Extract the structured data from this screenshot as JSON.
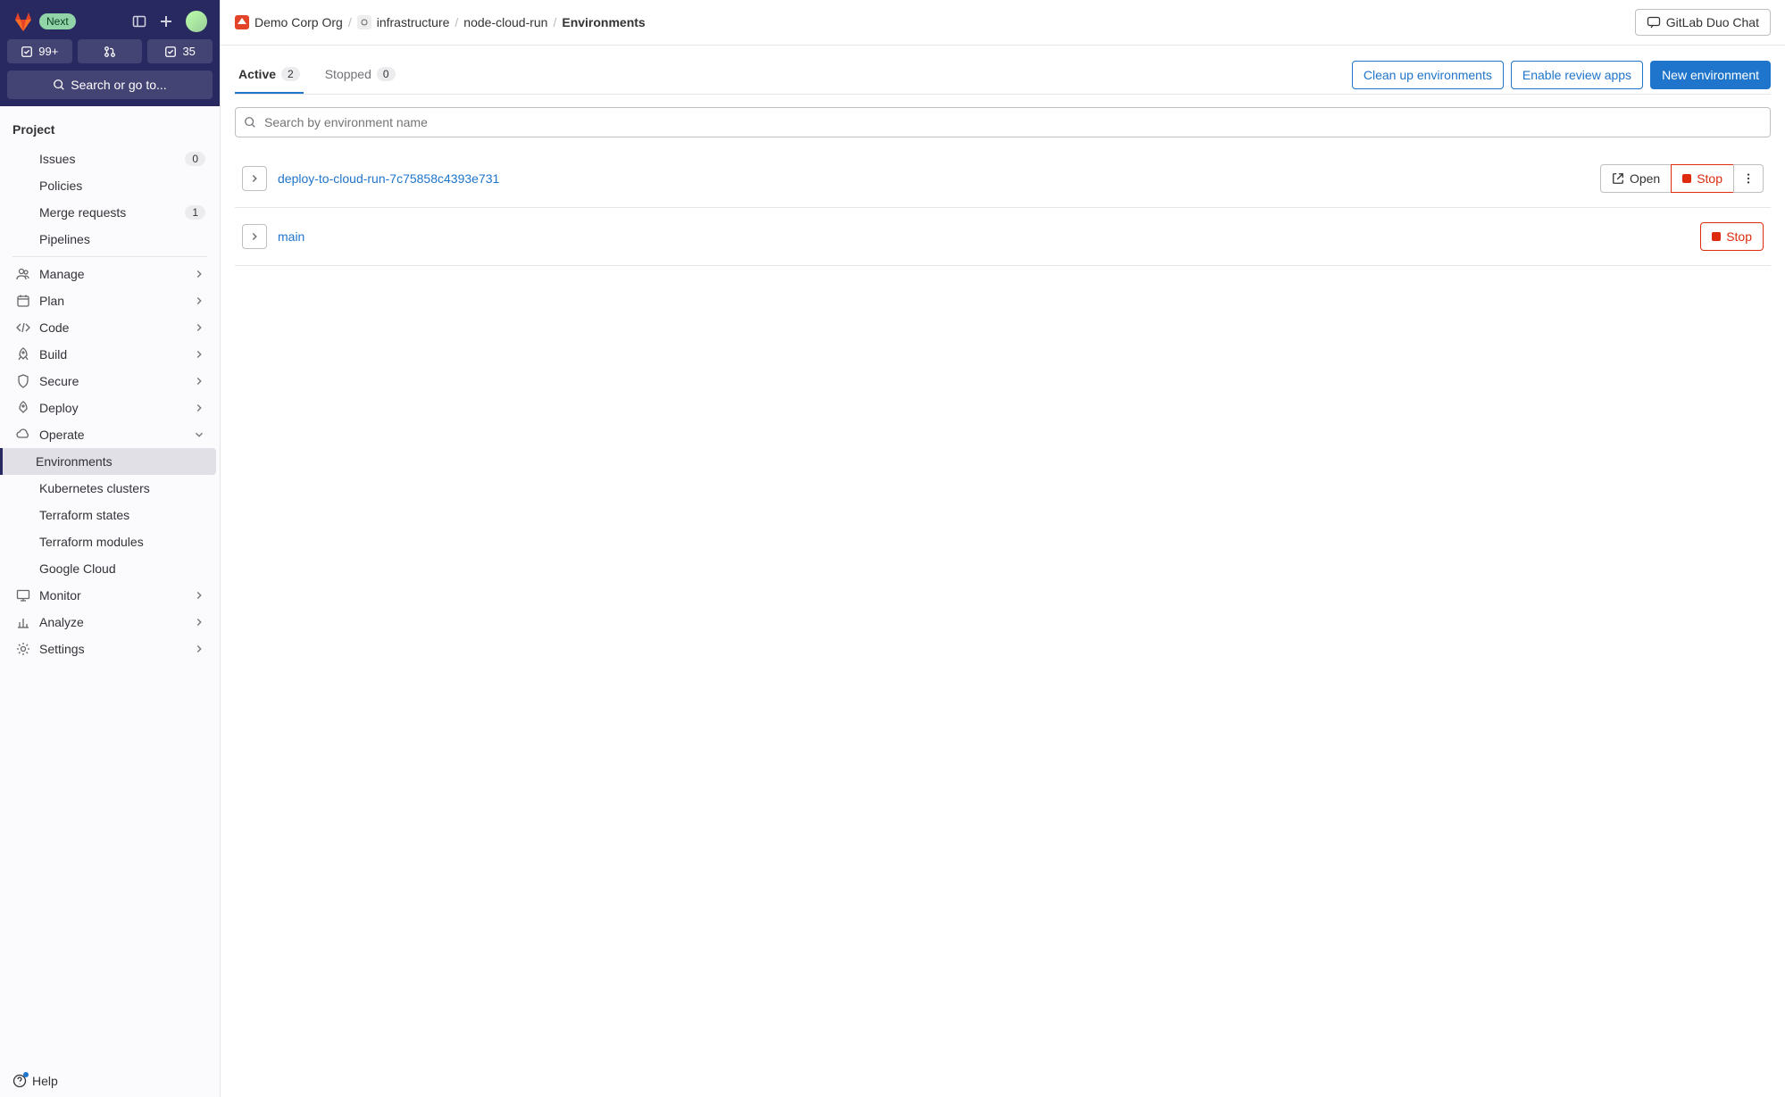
{
  "header": {
    "next_badge": "Next",
    "todo_count": "99+",
    "review_count": "35",
    "search_label": "Search or go to..."
  },
  "sidebar": {
    "section_title": "Project",
    "top_items": [
      {
        "label": "Issues",
        "badge": "0"
      },
      {
        "label": "Policies"
      },
      {
        "label": "Merge requests",
        "badge": "1"
      },
      {
        "label": "Pipelines"
      }
    ],
    "nav": [
      {
        "label": "Manage"
      },
      {
        "label": "Plan"
      },
      {
        "label": "Code"
      },
      {
        "label": "Build"
      },
      {
        "label": "Secure"
      },
      {
        "label": "Deploy"
      },
      {
        "label": "Operate",
        "expanded": true
      },
      {
        "label": "Monitor"
      },
      {
        "label": "Analyze"
      },
      {
        "label": "Settings"
      }
    ],
    "operate_sub": [
      {
        "label": "Environments",
        "active": true
      },
      {
        "label": "Kubernetes clusters"
      },
      {
        "label": "Terraform states"
      },
      {
        "label": "Terraform modules"
      },
      {
        "label": "Google Cloud"
      }
    ],
    "help_label": "Help"
  },
  "breadcrumbs": {
    "items": [
      {
        "label": "Demo Corp Org"
      },
      {
        "label": "infrastructure"
      },
      {
        "label": "node-cloud-run"
      },
      {
        "label": "Environments",
        "current": true
      }
    ]
  },
  "duo_chat_label": "GitLab Duo Chat",
  "tabs": {
    "active": {
      "label": "Active",
      "count": "2"
    },
    "stopped": {
      "label": "Stopped",
      "count": "0"
    }
  },
  "actions": {
    "cleanup": "Clean up environments",
    "review": "Enable review apps",
    "new": "New environment"
  },
  "search": {
    "placeholder": "Search by environment name"
  },
  "environments": [
    {
      "name": "deploy-to-cloud-run-7c75858c4393e731",
      "open": "Open",
      "stop": "Stop",
      "has_open": true,
      "has_menu": true
    },
    {
      "name": "main",
      "stop": "Stop",
      "has_open": false,
      "has_menu": false
    }
  ]
}
